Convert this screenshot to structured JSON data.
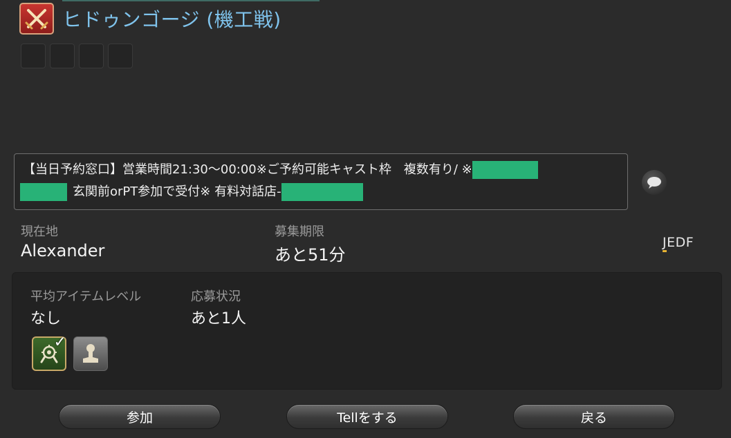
{
  "duty": {
    "title": "ヒドゥンゴージ (機工戦)",
    "icon": "crossed-swords-icon"
  },
  "comment": {
    "line1": "【当日予約窓口】営業時間21:30～00:00※ご予約可能キャスト枠　複数有り/ ※",
    "line2_a": "玄関前orPT参加で受付※ 有料対話店-",
    "redaction_color": "#28b277"
  },
  "location": {
    "label": "現在地",
    "value": "Alexander"
  },
  "deadline": {
    "label": "募集期限",
    "value": "あと51分"
  },
  "languages": {
    "j": "J",
    "rest": "EDF"
  },
  "party": {
    "ilvl_label": "平均アイテムレベル",
    "ilvl_value": "なし",
    "status_label": "応募状況",
    "status_value": "あと1人",
    "slots": [
      {
        "icon": "filled-member-icon",
        "filled": true
      },
      {
        "icon": "open-slot-icon",
        "filled": false
      }
    ]
  },
  "buttons": {
    "join": "参加",
    "tell": "Tellをする",
    "back": "戻る"
  },
  "colors": {
    "title": "#7fc3ec",
    "accent_gold": "#e6b334",
    "background": "#2b2b2b"
  }
}
